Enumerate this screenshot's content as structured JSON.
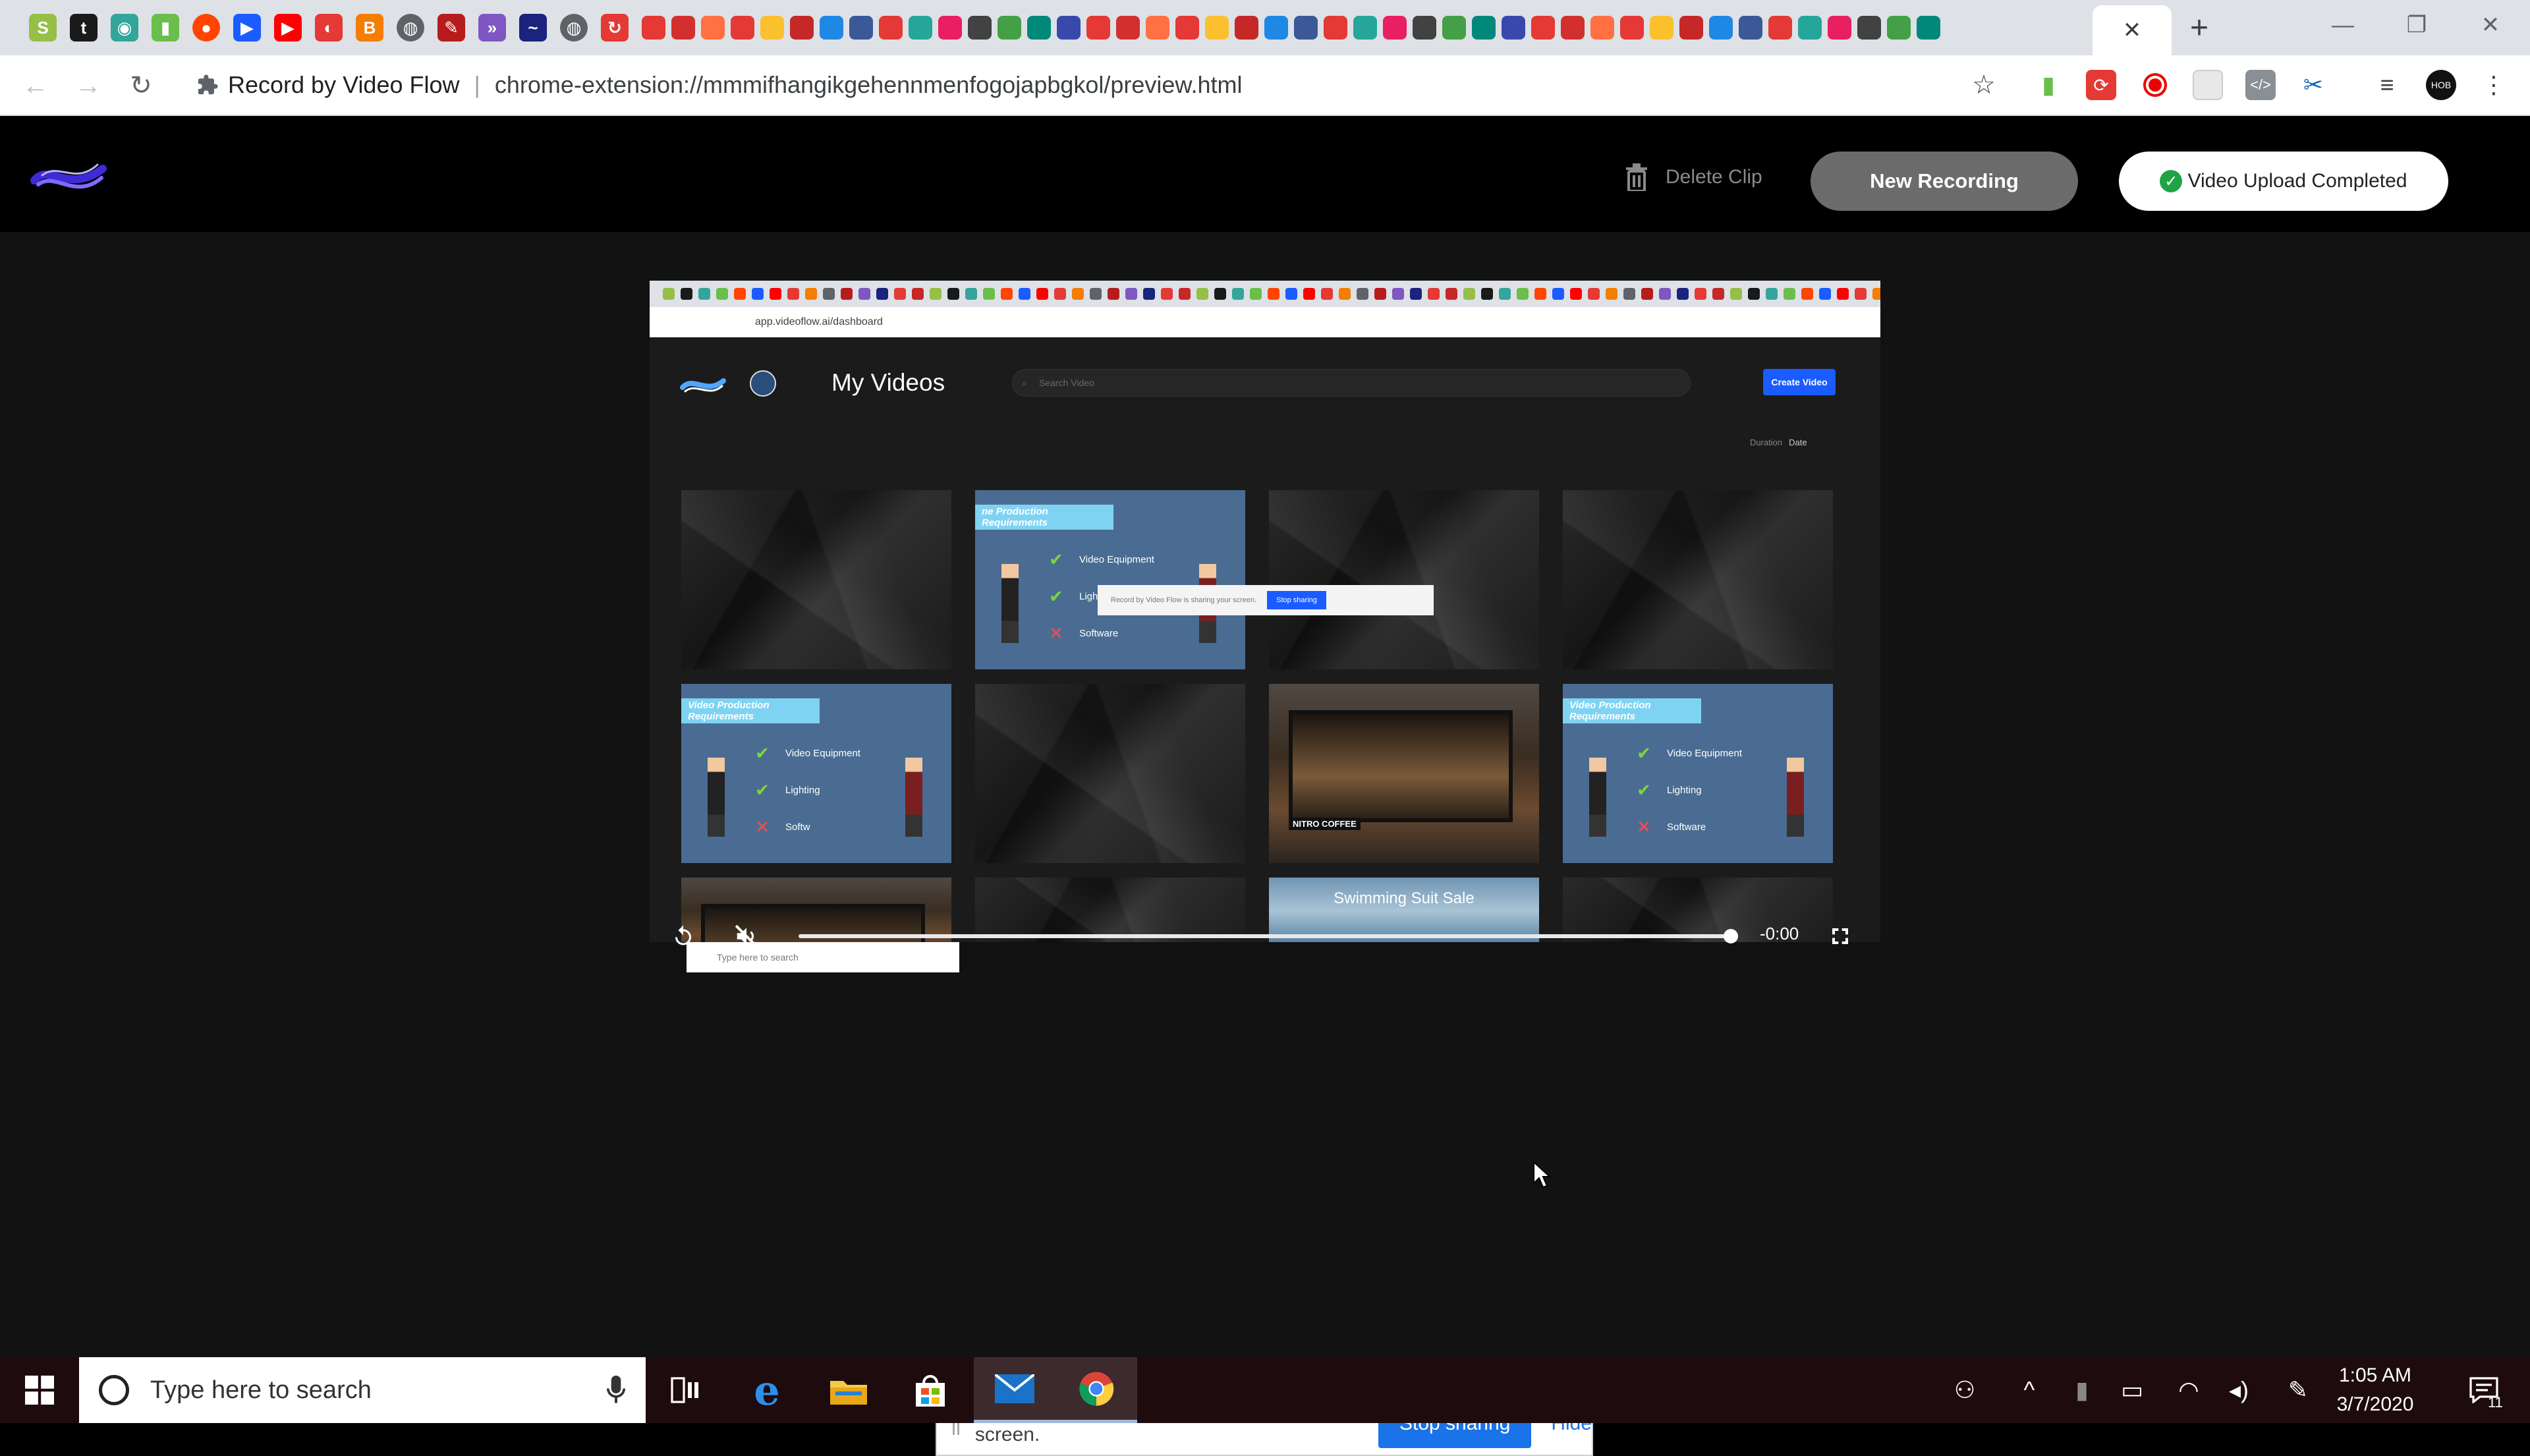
{
  "browser": {
    "active_tab_close": "✕",
    "new_tab": "+",
    "site_title": "Record by Video Flow",
    "url": "chrome-extension://mmmifhangikgehennmenfogojapbgkol/preview.html",
    "favicons": [
      {
        "icon": "shopify-icon",
        "color": "#95bf47",
        "glyph": "S"
      },
      {
        "icon": "tumblr-icon",
        "color": "#1a1a1a",
        "glyph": "t"
      },
      {
        "icon": "owl-icon",
        "color": "#34a59b",
        "glyph": "◉"
      },
      {
        "icon": "audio-wave-icon",
        "color": "#6abf4b",
        "glyph": "▮"
      },
      {
        "icon": "reddit-icon",
        "color": "#ff4500",
        "glyph": "●"
      },
      {
        "icon": "play-arrow-icon",
        "color": "#1a5cff",
        "glyph": "▶"
      },
      {
        "icon": "youtube-icon",
        "color": "#ff0000",
        "glyph": "▶"
      },
      {
        "icon": "red-app-icon",
        "color": "#e53935",
        "glyph": "◐"
      },
      {
        "icon": "blogger-icon",
        "color": "#f57d00",
        "glyph": "B"
      },
      {
        "icon": "globe-icon",
        "color": "#5f6368",
        "glyph": "◍"
      },
      {
        "icon": "pen-icon",
        "color": "#b71c1c",
        "glyph": "✎"
      },
      {
        "icon": "arrow-icon",
        "color": "#7e57c2",
        "glyph": "»"
      },
      {
        "icon": "wave-logo-icon",
        "color": "#1a237e",
        "glyph": "~"
      },
      {
        "icon": "globe-icon",
        "color": "#5f6368",
        "glyph": "◍"
      },
      {
        "icon": "refresh-red-icon",
        "color": "#e53935",
        "glyph": "↻"
      }
    ],
    "mini_favicon_count": 44
  },
  "app": {
    "delete_clip": "Delete Clip",
    "new_recording": "New Recording",
    "upload_status": "Video Upload Completed",
    "check_glyph": "✓"
  },
  "video": {
    "inner_url": "app.videoflow.ai/dashboard",
    "page_title": "My Videos",
    "search_placeholder": "Search Video",
    "create_button": "Create Video",
    "sort_label": "Duration",
    "sort_active": "Date",
    "thumbnails": [
      {
        "type": "dark"
      },
      {
        "type": "blue",
        "bar": "ne Production Requirements",
        "items": [
          [
            "✔",
            "Video Equipment"
          ],
          [
            "✔",
            "Lighting"
          ],
          [
            "✕",
            "Software"
          ]
        ]
      },
      {
        "type": "dark"
      },
      {
        "type": "dark"
      },
      {
        "type": "blue",
        "bar": "Video Production Requirements",
        "items": [
          [
            "✔",
            "Video Equipment"
          ],
          [
            "✔",
            "Lighting"
          ],
          [
            "✕",
            "Softw"
          ]
        ]
      },
      {
        "type": "dark"
      },
      {
        "type": "store",
        "label": "NITRO COFFEE"
      },
      {
        "type": "blue",
        "bar": "Video Production Requirements",
        "items": [
          [
            "✔",
            "Video Equipment"
          ],
          [
            "✔",
            "Lighting"
          ],
          [
            "✕",
            "Software"
          ]
        ]
      },
      {
        "type": "store",
        "label": ""
      },
      {
        "type": "dark"
      },
      {
        "type": "sea",
        "label": "Swimming Suit Sale"
      },
      {
        "type": "dark"
      }
    ],
    "inner_share_text": "Record by Video Flow is sharing your screen.",
    "inner_stop": "Stop sharing",
    "inner_taskbar_search": "Type here to search",
    "time": "-0:00",
    "progress": 1.0
  },
  "share_bar": {
    "message": "Record by Video Flow is sharing your screen.",
    "stop": "Stop sharing",
    "hide": "Hide"
  },
  "taskbar": {
    "search_placeholder": "Type here to search",
    "time": "1:05 AM",
    "date": "3/7/2020",
    "notification_count": "11"
  }
}
